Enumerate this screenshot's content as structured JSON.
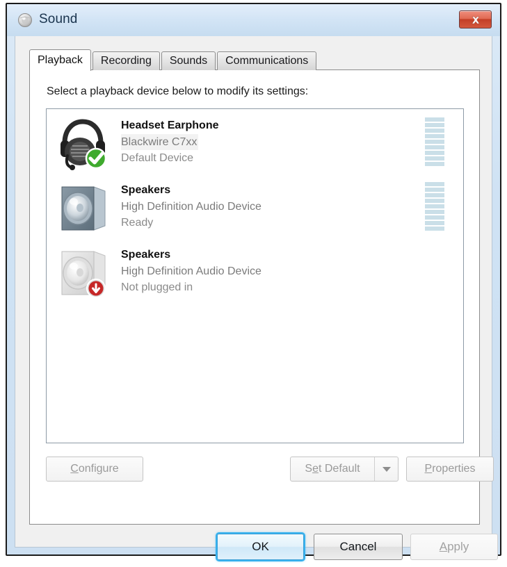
{
  "window": {
    "title": "Sound",
    "icon": "sound-speaker-icon",
    "close_label": "Close"
  },
  "tabs": [
    {
      "label": "Playback",
      "active": true
    },
    {
      "label": "Recording",
      "active": false
    },
    {
      "label": "Sounds",
      "active": false
    },
    {
      "label": "Communications",
      "active": false
    }
  ],
  "playback": {
    "instruction": "Select a playback device below to modify its settings:",
    "devices": [
      {
        "name": "Headset Earphone",
        "description": "Blackwire C7xx",
        "status": "Default Device",
        "icon": "headset-icon",
        "badge": "green-check-badge",
        "meter_segments": 9,
        "description_highlighted": true
      },
      {
        "name": "Speakers",
        "description": "High Definition Audio Device",
        "status": "Ready",
        "icon": "speaker-icon-active",
        "badge": "none",
        "meter_segments": 9,
        "description_highlighted": false
      },
      {
        "name": "Speakers",
        "description": "High Definition Audio Device",
        "status": "Not plugged in",
        "icon": "speaker-icon-disabled",
        "badge": "red-down-arrow-badge",
        "meter_segments": 0,
        "description_highlighted": false
      }
    ],
    "buttons": {
      "configure": {
        "accel": "C",
        "rest": "onfigure",
        "enabled": false
      },
      "set_default": {
        "pre": "S",
        "accel": "e",
        "rest": "t Default",
        "enabled": false,
        "has_dropdown": true
      },
      "properties": {
        "accel": "P",
        "rest": "roperties",
        "enabled": false
      }
    }
  },
  "footer": {
    "ok": "OK",
    "cancel": "Cancel",
    "apply_accel": "A",
    "apply_rest": "pply",
    "apply_enabled": false
  },
  "colors": {
    "accent": "#36b1ee",
    "meter": "#cadfe8",
    "close_button": "#c33e26",
    "title_text": "#19334d"
  }
}
